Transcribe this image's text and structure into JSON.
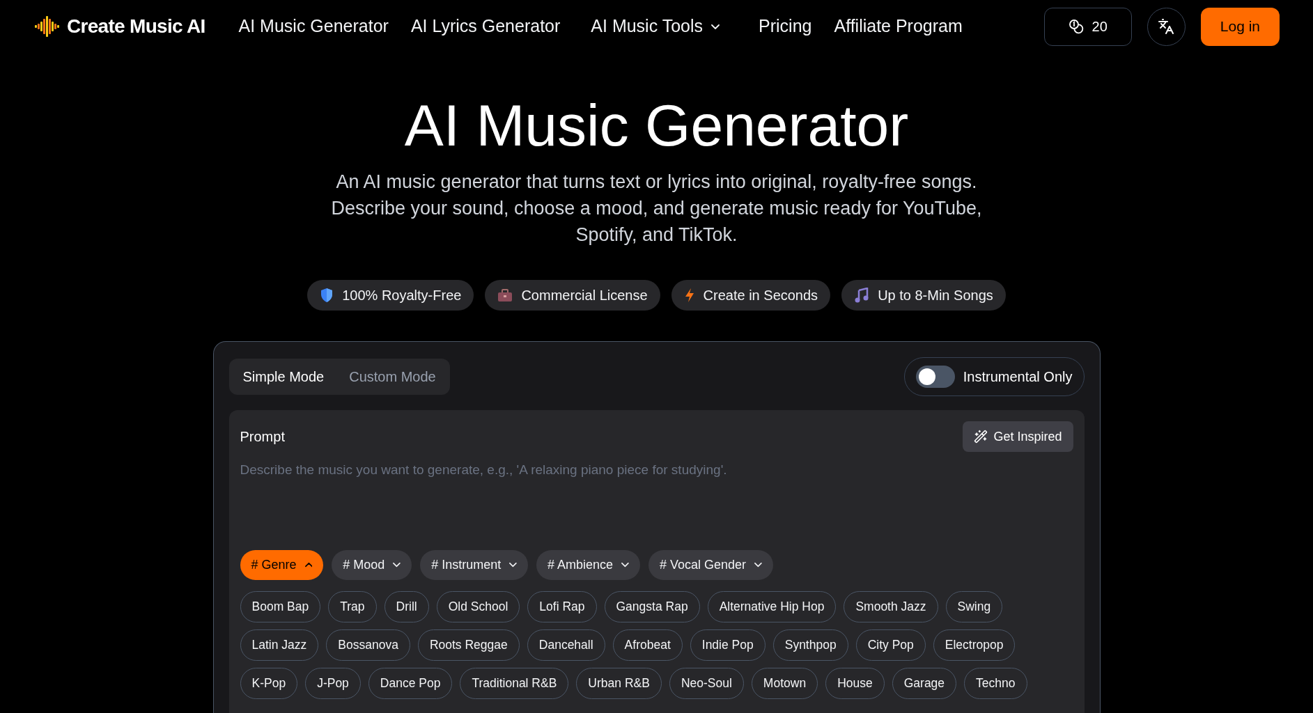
{
  "header": {
    "brand": "Create Music AI",
    "nav": [
      {
        "label": "AI Music Generator",
        "kind": "link"
      },
      {
        "label": "AI Lyrics Generator",
        "kind": "link"
      },
      {
        "label": "AI Music Tools",
        "kind": "dropdown"
      },
      {
        "label": "Pricing",
        "kind": "link"
      },
      {
        "label": "Affiliate Program",
        "kind": "link"
      }
    ],
    "credits": "20",
    "login": "Log in"
  },
  "hero": {
    "title": "AI Music Generator",
    "subtitle": "An AI music generator that turns text or lyrics into original, royalty-free songs. Describe your sound, choose a mood, and generate music ready for YouTube, Spotify, and TikTok."
  },
  "badges": [
    "100% Royalty-Free",
    "Commercial License",
    "Create in Seconds",
    "Up to 8-Min Songs"
  ],
  "panel": {
    "modes": [
      {
        "label": "Simple Mode",
        "selected": true
      },
      {
        "label": "Custom Mode",
        "selected": false
      }
    ],
    "instrumental": {
      "label": "Instrumental Only",
      "on": false
    },
    "prompt": {
      "label": "Prompt",
      "inspire": "Get Inspired",
      "placeholder": "Describe the music you want to generate, e.g., 'A relaxing piano piece for studying'."
    },
    "categories": [
      {
        "label": "# Genre",
        "selected": true,
        "expanded": true
      },
      {
        "label": "# Mood",
        "selected": false,
        "expanded": false
      },
      {
        "label": "# Instrument",
        "selected": false,
        "expanded": false
      },
      {
        "label": "# Ambience",
        "selected": false,
        "expanded": false
      },
      {
        "label": "# Vocal Gender",
        "selected": false,
        "expanded": false
      }
    ],
    "tag_rows": [
      [
        "Boom Bap",
        "Trap",
        "Drill",
        "Old School",
        "Lofi Rap",
        "Gangsta Rap",
        "Alternative Hip Hop",
        "Smooth Jazz",
        "Swing"
      ],
      [
        "Latin Jazz",
        "Bossanova",
        "Roots Reggae",
        "Dancehall",
        "Afrobeat",
        "Indie Pop",
        "Synthpop",
        "City Pop",
        "Electropop"
      ],
      [
        "K-Pop",
        "J-Pop",
        "Dance Pop",
        "Traditional R&B",
        "Urban R&B",
        "Neo-Soul",
        "Motown",
        "House",
        "Garage",
        "Techno"
      ]
    ]
  }
}
